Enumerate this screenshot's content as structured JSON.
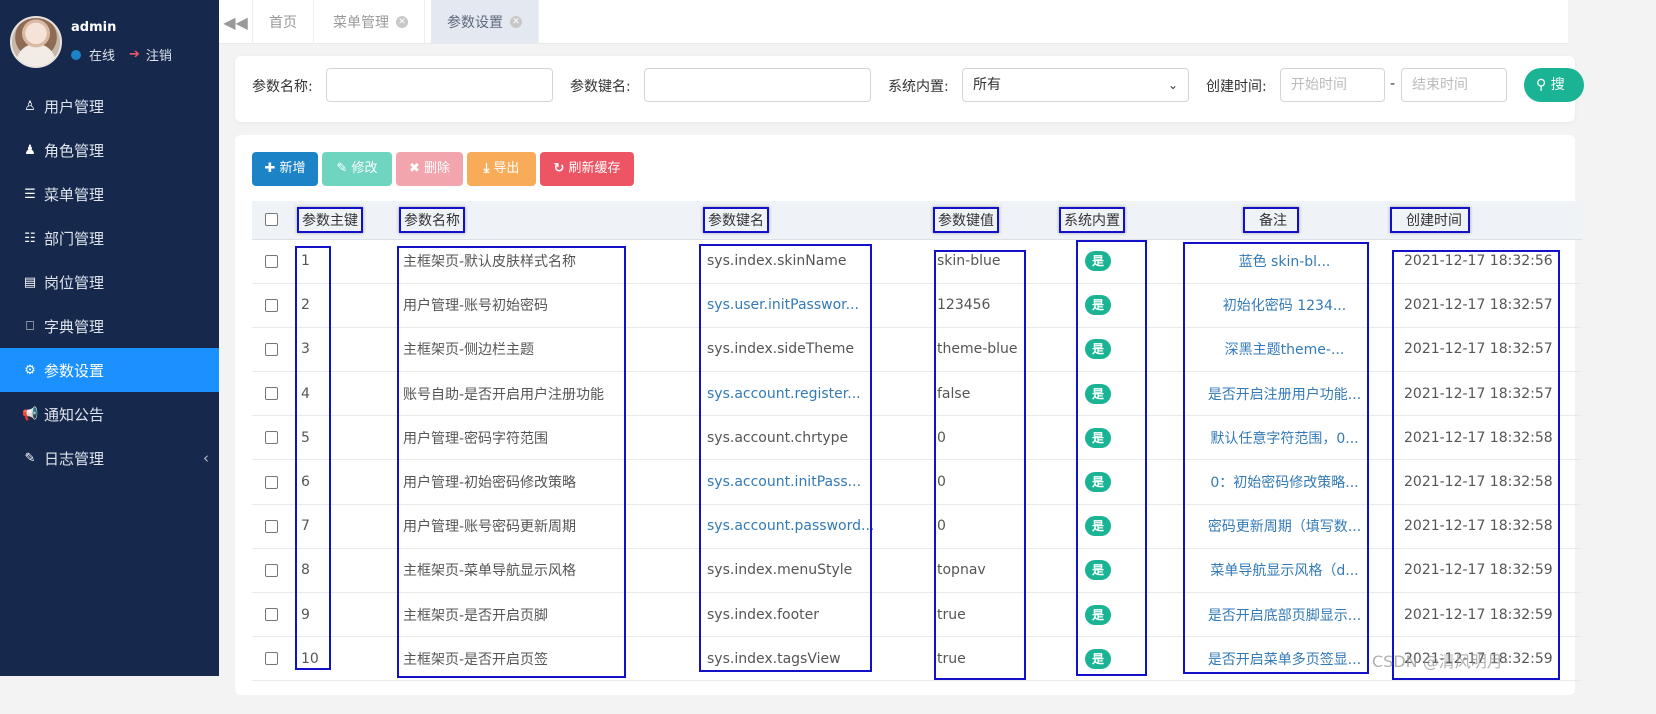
{
  "user": {
    "name": "admin",
    "status": "在线",
    "logout": "注销"
  },
  "menu": [
    {
      "label": "用户管理",
      "icon": "user-icon",
      "glyph": "♙",
      "active": false
    },
    {
      "label": "角色管理",
      "icon": "role-icon",
      "glyph": "♟",
      "active": false
    },
    {
      "label": "菜单管理",
      "icon": "list-icon",
      "glyph": "☰",
      "active": false
    },
    {
      "label": "部门管理",
      "icon": "outdent-icon",
      "glyph": "☷",
      "active": false
    },
    {
      "label": "岗位管理",
      "icon": "id-card-icon",
      "glyph": "▤",
      "active": false
    },
    {
      "label": "字典管理",
      "icon": "bookmark-icon",
      "glyph": "⎕",
      "active": false
    },
    {
      "label": "参数设置",
      "icon": "gear-icon",
      "glyph": "⚙",
      "active": true
    },
    {
      "label": "通知公告",
      "icon": "bullhorn-icon",
      "glyph": "📢",
      "active": false
    },
    {
      "label": "日志管理",
      "icon": "edit-icon",
      "glyph": "✎",
      "active": false
    }
  ],
  "tabs": [
    {
      "label": "首页",
      "closable": false,
      "active": false
    },
    {
      "label": "菜单管理",
      "closable": true,
      "active": false
    },
    {
      "label": "参数设置",
      "closable": true,
      "active": true
    }
  ],
  "search": {
    "config_name_label": "参数名称:",
    "config_key_label": "参数键名:",
    "config_type_label": "系统内置:",
    "config_type_value": "所有",
    "create_time_label": "创建时间:",
    "begin_time_placeholder": "开始时间",
    "end_time_placeholder": "结束时间",
    "range_separator": "-",
    "search_button": "搜"
  },
  "toolbar": {
    "add": "新增",
    "edit": "修改",
    "remove": "删除",
    "export": "导出",
    "refresh": "刷新缓存",
    "colors": {
      "add": "#1c84c6",
      "edit": "#6fd5c1",
      "remove": "#f3a5ad",
      "export": "#f8ac59",
      "refresh": "#ed5565"
    }
  },
  "table": {
    "headers": [
      "参数主键",
      "参数名称",
      "参数键名",
      "参数键值",
      "系统内置",
      "备注",
      "创建时间"
    ],
    "rows": [
      {
        "id": "1",
        "name": "主框架页-默认皮肤样式名称",
        "key": "sys.index.skinName",
        "key_link": false,
        "value": "skin-blue",
        "builtin": "是",
        "remark": "蓝色 skin-bl...",
        "time": "2021-12-17 18:32:56"
      },
      {
        "id": "2",
        "name": "用户管理-账号初始密码",
        "key": "sys.user.initPasswor...",
        "key_link": true,
        "value": "123456",
        "builtin": "是",
        "remark": "初始化密码 1234...",
        "time": "2021-12-17 18:32:57"
      },
      {
        "id": "3",
        "name": "主框架页-侧边栏主题",
        "key": "sys.index.sideTheme",
        "key_link": false,
        "value": "theme-blue",
        "builtin": "是",
        "remark": "深黑主题theme-...",
        "time": "2021-12-17 18:32:57"
      },
      {
        "id": "4",
        "name": "账号自助-是否开启用户注册功能",
        "key": "sys.account.register...",
        "key_link": true,
        "value": "false",
        "builtin": "是",
        "remark": "是否开启注册用户功能...",
        "time": "2021-12-17 18:32:57"
      },
      {
        "id": "5",
        "name": "用户管理-密码字符范围",
        "key": "sys.account.chrtype",
        "key_link": false,
        "value": "0",
        "builtin": "是",
        "remark": "默认任意字符范围，0...",
        "time": "2021-12-17 18:32:58"
      },
      {
        "id": "6",
        "name": "用户管理-初始密码修改策略",
        "key": "sys.account.initPass...",
        "key_link": true,
        "value": "0",
        "builtin": "是",
        "remark": "0：初始密码修改策略...",
        "time": "2021-12-17 18:32:58"
      },
      {
        "id": "7",
        "name": "用户管理-账号密码更新周期",
        "key": "sys.account.password...",
        "key_link": true,
        "value": "0",
        "builtin": "是",
        "remark": "密码更新周期（填写数...",
        "time": "2021-12-17 18:32:58"
      },
      {
        "id": "8",
        "name": "主框架页-菜单导航显示风格",
        "key": "sys.index.menuStyle",
        "key_link": false,
        "value": "topnav",
        "builtin": "是",
        "remark": "菜单导航显示风格（d...",
        "time": "2021-12-17 18:32:59"
      },
      {
        "id": "9",
        "name": "主框架页-是否开启页脚",
        "key": "sys.index.footer",
        "key_link": false,
        "value": "true",
        "builtin": "是",
        "remark": "是否开启底部页脚显示...",
        "time": "2021-12-17 18:32:59"
      },
      {
        "id": "10",
        "name": "主框架页-是否开启页签",
        "key": "sys.index.tagsView",
        "key_link": false,
        "value": "true",
        "builtin": "是",
        "remark": "是否开启菜单多页签显...",
        "time": "2021-12-17 18:32:59"
      }
    ]
  },
  "watermark": "CSDN @清风明月-",
  "colors": {
    "sidebar": "#16284b",
    "active_menu": "#1a91ff",
    "badge": "#1ab394",
    "link": "#337ab7",
    "annotation_box": "#1111cc"
  }
}
